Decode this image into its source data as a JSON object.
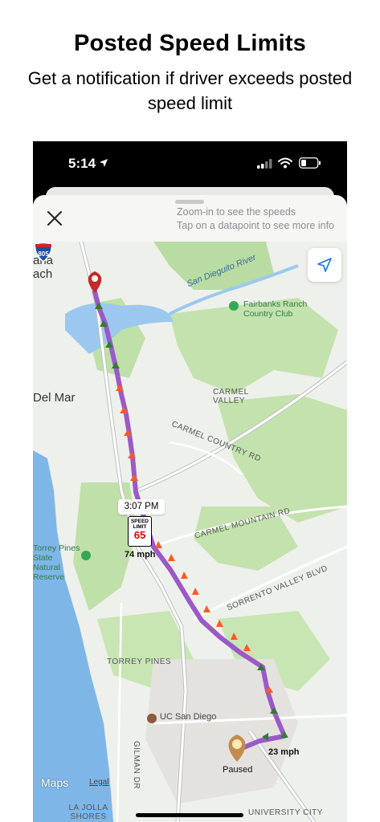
{
  "headline": "Posted Speed Limits",
  "subline": "Get a notification if driver exceeds posted speed limit",
  "status": {
    "time": "5:14"
  },
  "sheet": {
    "hint_line1": "Zoom-in to see the speeds",
    "hint_line2": "Tap on a datapoint to see more info"
  },
  "map": {
    "labels": {
      "rancho": "ana",
      "rancho2": "ach",
      "del_mar": "Del Mar",
      "river": "San Dieguito River",
      "fairbanks": "Fairbanks Ranch Country Club",
      "carmel_valley": "CARMEL VALLEY",
      "carmel_country_rd": "CARMEL COUNTRY RD",
      "carmel_mountain_rd": "CARMEL MOUNTAIN RD",
      "sorrento_valley_blvd": "SORRENTO VALLEY BLVD",
      "torrey_pines_park": "Torrey Pines State Natural Reserve",
      "torrey_pines": "TORREY PINES",
      "uc_san_diego": "UC San Diego",
      "gilman_dr": "GILMAN DR",
      "la_jolla_shores": "LA JOLLA SHORES",
      "university_city": "UNIVERSITY CITY",
      "interstate": "805"
    },
    "callouts": {
      "time": "3:07 PM",
      "speed_limit_title": "SPEED LIMIT",
      "speed_limit_value": "65",
      "speed_1": "74 mph",
      "speed_2": "23 mph",
      "paused": "Paused"
    },
    "attribution": {
      "logo": "Maps",
      "legal": "Legal"
    },
    "colors": {
      "route": "#9b59c8",
      "arrow_green": "#2e7d32",
      "arrow_orange": "#ff5a1f",
      "water": "#7fb6e8",
      "park": "#b8dca2",
      "pin_red": "#c62828",
      "pin_tan": "#c48b50"
    }
  }
}
